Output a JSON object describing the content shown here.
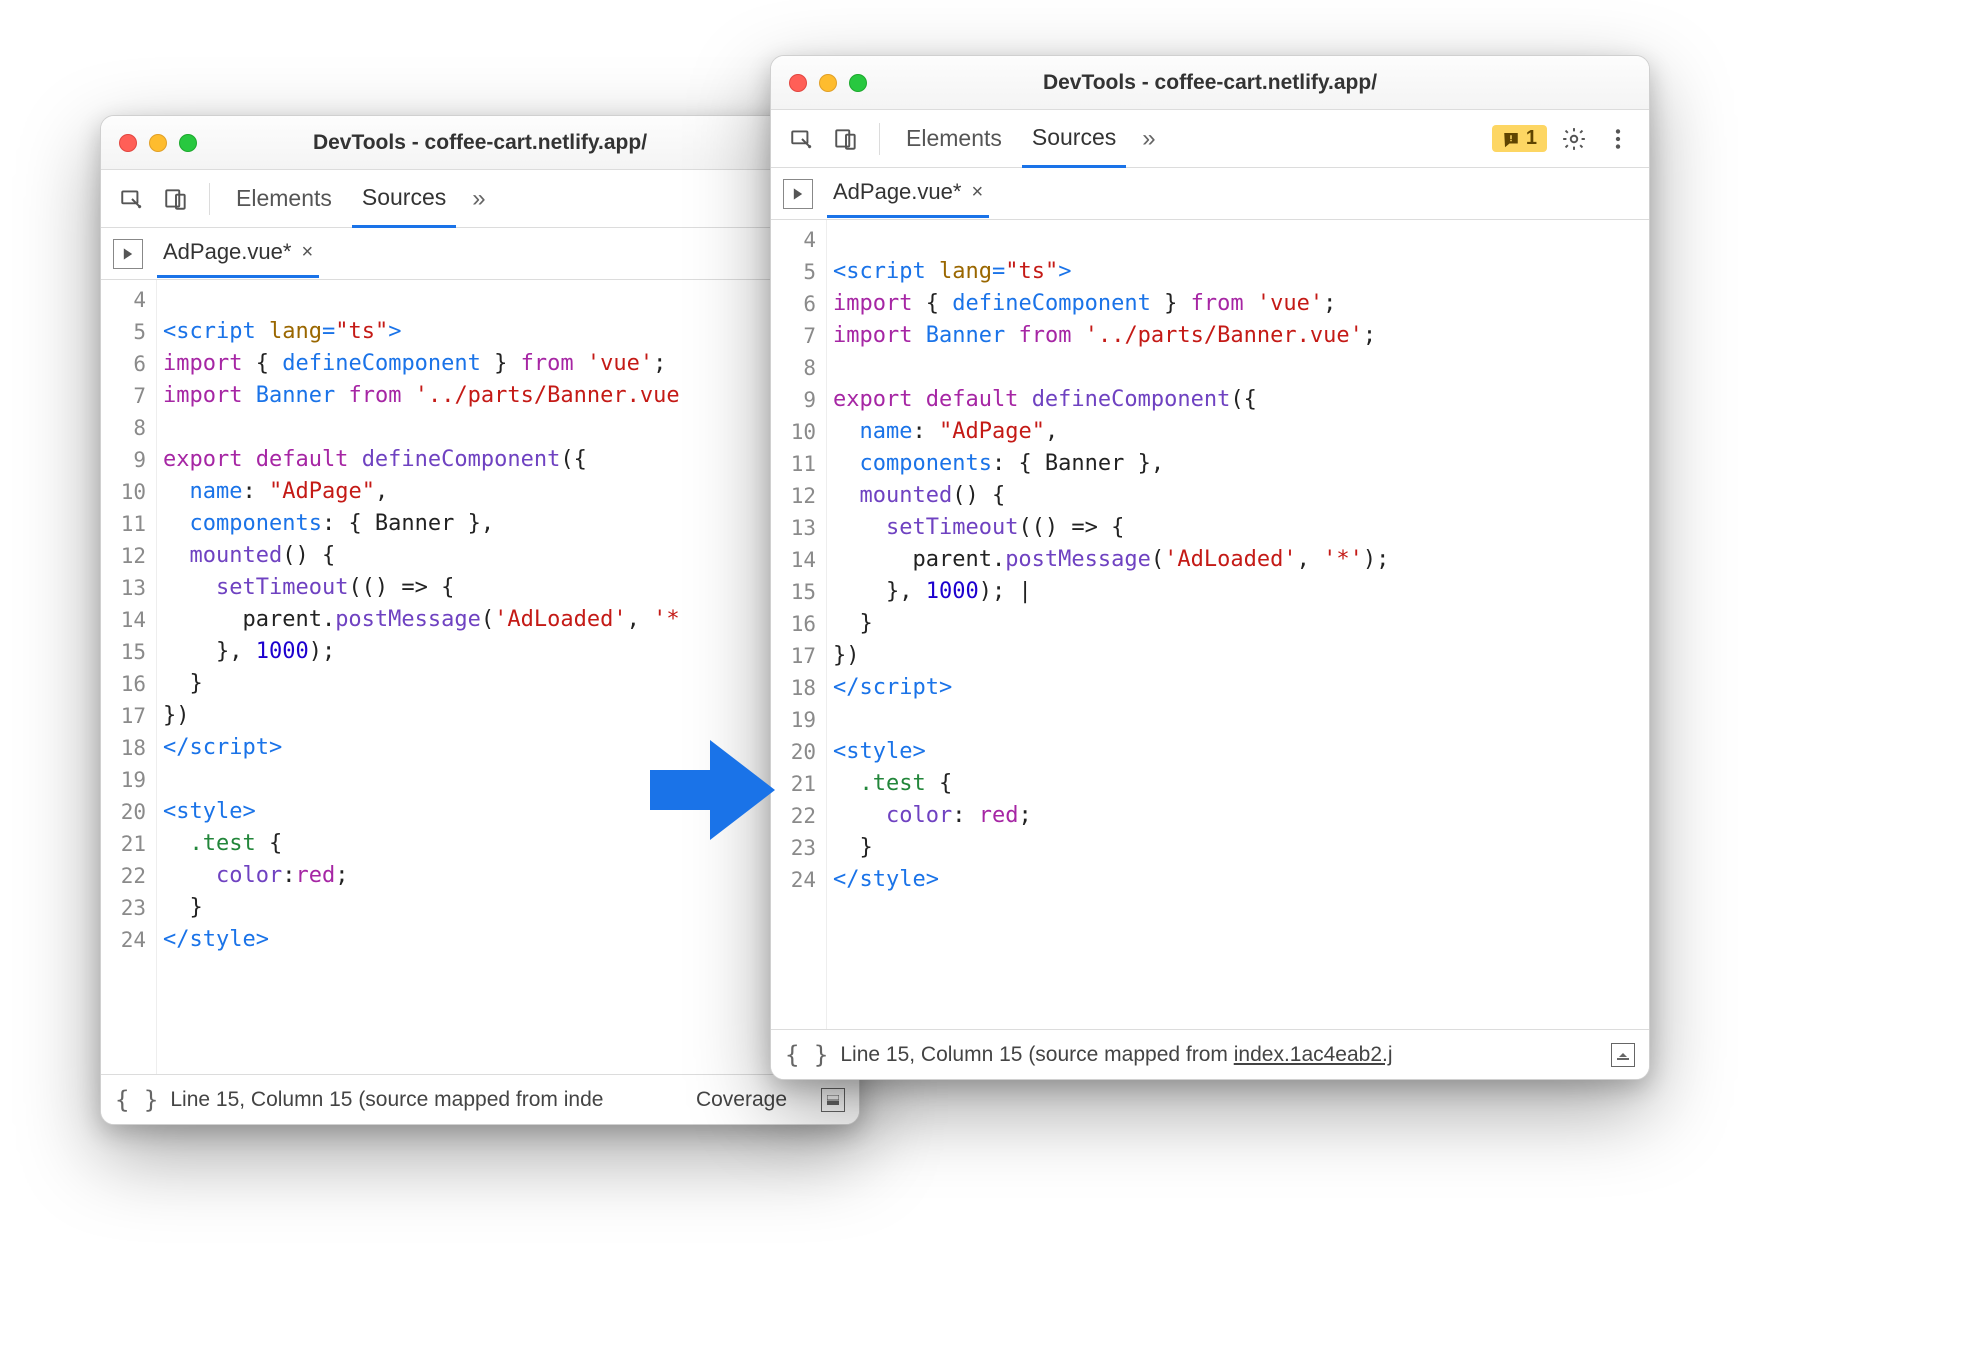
{
  "window_title": "DevTools - coffee-cart.netlify.app/",
  "tabs": {
    "elements": "Elements",
    "sources": "Sources"
  },
  "file_tab": "AdPage.vue*",
  "warning_count": "1",
  "statusbar": {
    "left": "Line 15, Column 15  (source mapped from inde",
    "coverage": "Coverage",
    "right": "Line 15, Column 15  (source mapped from ",
    "right_link": "index.1ac4eab2.j"
  },
  "left_code": {
    "start": 4,
    "lines": [
      [],
      [
        [
          "tag",
          "<script "
        ],
        [
          "attr",
          "lang"
        ],
        [
          "tag",
          "="
        ],
        [
          "str",
          "\"ts\""
        ],
        [
          "tag",
          ">"
        ]
      ],
      [
        [
          "kw",
          "import"
        ],
        [
          "plain",
          " { "
        ],
        [
          "def",
          "defineComponent"
        ],
        [
          "plain",
          " } "
        ],
        [
          "kw",
          "from"
        ],
        [
          "plain",
          " "
        ],
        [
          "str",
          "'vue'"
        ],
        [
          "plain",
          ";"
        ]
      ],
      [
        [
          "kw",
          "import"
        ],
        [
          "plain",
          " "
        ],
        [
          "def",
          "Banner"
        ],
        [
          "plain",
          " "
        ],
        [
          "kw",
          "from"
        ],
        [
          "plain",
          " "
        ],
        [
          "str",
          "'../parts/Banner.vue"
        ]
      ],
      [],
      [
        [
          "kw",
          "export default"
        ],
        [
          "plain",
          " "
        ],
        [
          "name",
          "defineComponent"
        ],
        [
          "plain",
          "({"
        ]
      ],
      [
        [
          "plain",
          "  "
        ],
        [
          "def",
          "name"
        ],
        [
          "plain",
          ": "
        ],
        [
          "str",
          "\"AdPage\""
        ],
        [
          "plain",
          ","
        ]
      ],
      [
        [
          "plain",
          "  "
        ],
        [
          "def",
          "components"
        ],
        [
          "plain",
          ": { Banner },"
        ]
      ],
      [
        [
          "plain",
          "  "
        ],
        [
          "name",
          "mounted"
        ],
        [
          "plain",
          "() {"
        ]
      ],
      [
        [
          "plain",
          "    "
        ],
        [
          "name",
          "setTimeout"
        ],
        [
          "plain",
          "(() => {"
        ]
      ],
      [
        [
          "plain",
          "      parent."
        ],
        [
          "name",
          "postMessage"
        ],
        [
          "plain",
          "("
        ],
        [
          "str",
          "'AdLoaded'"
        ],
        [
          "plain",
          ", "
        ],
        [
          "str",
          "'*"
        ]
      ],
      [
        [
          "plain",
          "    }, "
        ],
        [
          "num",
          "1000"
        ],
        [
          "plain",
          ");"
        ]
      ],
      [
        [
          "plain",
          "  }"
        ]
      ],
      [
        [
          "plain",
          "})"
        ]
      ],
      [
        [
          "tag",
          "</"
        ],
        [
          "tag",
          "script"
        ],
        [
          "tag",
          ">"
        ]
      ],
      [],
      [
        [
          "tag",
          "<style>"
        ]
      ],
      [
        [
          "plain",
          "  "
        ],
        [
          "class",
          ".test"
        ],
        [
          "plain",
          " {"
        ]
      ],
      [
        [
          "plain",
          "    "
        ],
        [
          "prop",
          "color"
        ],
        [
          "plain",
          ":"
        ],
        [
          "kw",
          "red"
        ],
        [
          "plain",
          ";"
        ]
      ],
      [
        [
          "plain",
          "  }"
        ]
      ],
      [
        [
          "tag",
          "</style>"
        ]
      ]
    ]
  },
  "right_code": {
    "start": 4,
    "lines": [
      [],
      [
        [
          "tag",
          "<script "
        ],
        [
          "attr",
          "lang"
        ],
        [
          "tag",
          "="
        ],
        [
          "str",
          "\"ts\""
        ],
        [
          "tag",
          ">"
        ]
      ],
      [
        [
          "kw",
          "import"
        ],
        [
          "plain",
          " { "
        ],
        [
          "def",
          "defineComponent"
        ],
        [
          "plain",
          " } "
        ],
        [
          "kw",
          "from"
        ],
        [
          "plain",
          " "
        ],
        [
          "str",
          "'vue'"
        ],
        [
          "plain",
          ";"
        ]
      ],
      [
        [
          "kw",
          "import"
        ],
        [
          "plain",
          " "
        ],
        [
          "def",
          "Banner"
        ],
        [
          "plain",
          " "
        ],
        [
          "kw",
          "from"
        ],
        [
          "plain",
          " "
        ],
        [
          "str",
          "'../parts/Banner.vue'"
        ],
        [
          "plain",
          ";"
        ]
      ],
      [],
      [
        [
          "kw",
          "export default"
        ],
        [
          "plain",
          " "
        ],
        [
          "name",
          "defineComponent"
        ],
        [
          "plain",
          "({"
        ]
      ],
      [
        [
          "plain",
          "  "
        ],
        [
          "def",
          "name"
        ],
        [
          "plain",
          ": "
        ],
        [
          "str",
          "\"AdPage\""
        ],
        [
          "plain",
          ","
        ]
      ],
      [
        [
          "plain",
          "  "
        ],
        [
          "def",
          "components"
        ],
        [
          "plain",
          ": { Banner },"
        ]
      ],
      [
        [
          "plain",
          "  "
        ],
        [
          "name",
          "mounted"
        ],
        [
          "plain",
          "() {"
        ]
      ],
      [
        [
          "plain",
          "    "
        ],
        [
          "name",
          "setTimeout"
        ],
        [
          "plain",
          "(() => {"
        ]
      ],
      [
        [
          "plain",
          "      parent."
        ],
        [
          "name",
          "postMessage"
        ],
        [
          "plain",
          "("
        ],
        [
          "str",
          "'AdLoaded'"
        ],
        [
          "plain",
          ", "
        ],
        [
          "str",
          "'*'"
        ],
        [
          "plain",
          ");"
        ]
      ],
      [
        [
          "plain",
          "    }, "
        ],
        [
          "num",
          "1000"
        ],
        [
          "plain",
          "); |"
        ]
      ],
      [
        [
          "plain",
          "  }"
        ]
      ],
      [
        [
          "plain",
          "})"
        ]
      ],
      [
        [
          "tag",
          "</"
        ],
        [
          "tag",
          "script"
        ],
        [
          "tag",
          ">"
        ]
      ],
      [],
      [
        [
          "tag",
          "<style>"
        ]
      ],
      [
        [
          "plain",
          "  "
        ],
        [
          "class",
          ".test"
        ],
        [
          "plain",
          " {"
        ]
      ],
      [
        [
          "plain",
          "    "
        ],
        [
          "prop",
          "color"
        ],
        [
          "plain",
          ": "
        ],
        [
          "kw",
          "red"
        ],
        [
          "plain",
          ";"
        ]
      ],
      [
        [
          "plain",
          "  }"
        ]
      ],
      [
        [
          "tag",
          "</style>"
        ]
      ]
    ]
  }
}
